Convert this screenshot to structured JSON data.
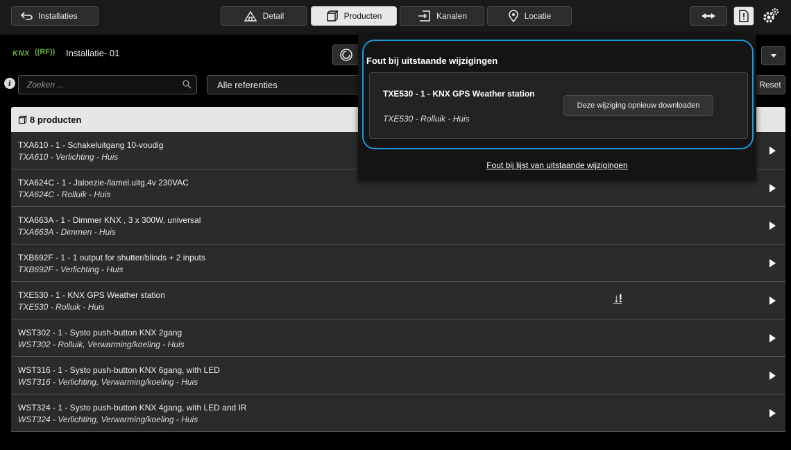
{
  "topbar": {
    "back_label": "Installaties",
    "tabs": [
      {
        "label": "Detail",
        "icon": "home-icon"
      },
      {
        "label": "Producten",
        "icon": "box-icon"
      },
      {
        "label": "Kanalen",
        "icon": "channel-icon"
      },
      {
        "label": "Locatie",
        "icon": "location-pin-icon"
      }
    ],
    "active_tab": "Producten"
  },
  "installation": {
    "knx_logo": "KNX",
    "rf_logo": "((RF))",
    "name": "Installatie- 01"
  },
  "filters": {
    "search_placeholder": "Zoeken ...",
    "reference_select": "Alle referenties",
    "reset_label": "Reset"
  },
  "list": {
    "header": "8 producten",
    "rows": [
      {
        "title": "TXA610 - 1 - Schakeluitgang 10-voudig",
        "sub": "TXA610 - Verlichting - Huis"
      },
      {
        "title": "TXA624C - 1 - Jaloezie-/lamel.uitg.4v 230VAC",
        "sub": "TXA624C - Rolluik - Huis"
      },
      {
        "title": "TXA663A - 1 - Dimmer KNX , 3 x 300W, universal",
        "sub": "TXA663A - Dimmen - Huis"
      },
      {
        "title": "TXB692F - 1 - 1 output for shutter/blinds + 2 inputs",
        "sub": "TXB692F - Verlichting - Huis"
      },
      {
        "title": "TXE530 - 1 - KNX GPS Weather station",
        "sub": "TXE530 - Rolluik - Huis",
        "warning": "↓!"
      },
      {
        "title": "WST302 - 1 - Systo push-button KNX 2gang",
        "sub": "WST302 - Rolluik, Verwarming/koeling - Huis"
      },
      {
        "title": "WST316 - 1 - Systo push-button KNX 6gang, with LED",
        "sub": "WST316 - Verlichting, Verwarming/koeling - Huis"
      },
      {
        "title": "WST324 - 1 - Systo push-button KNX 4gang, with LED and IR",
        "sub": "WST324 - Verlichting, Verwarming/koeling - Huis"
      }
    ]
  },
  "popover": {
    "title": "Fout bij uitstaande wijzigingen",
    "item_title": "TXE530 - 1 - KNX GPS Weather station",
    "item_sub": "TXE530 - Rolluik - Huis",
    "item_button": "Deze wijziging opnieuw downloaden",
    "link": "Fout bij lijst van uitstaande wijzigingen"
  },
  "colors": {
    "accent": "#1a9ad6",
    "knx_green": "#6db33f"
  }
}
